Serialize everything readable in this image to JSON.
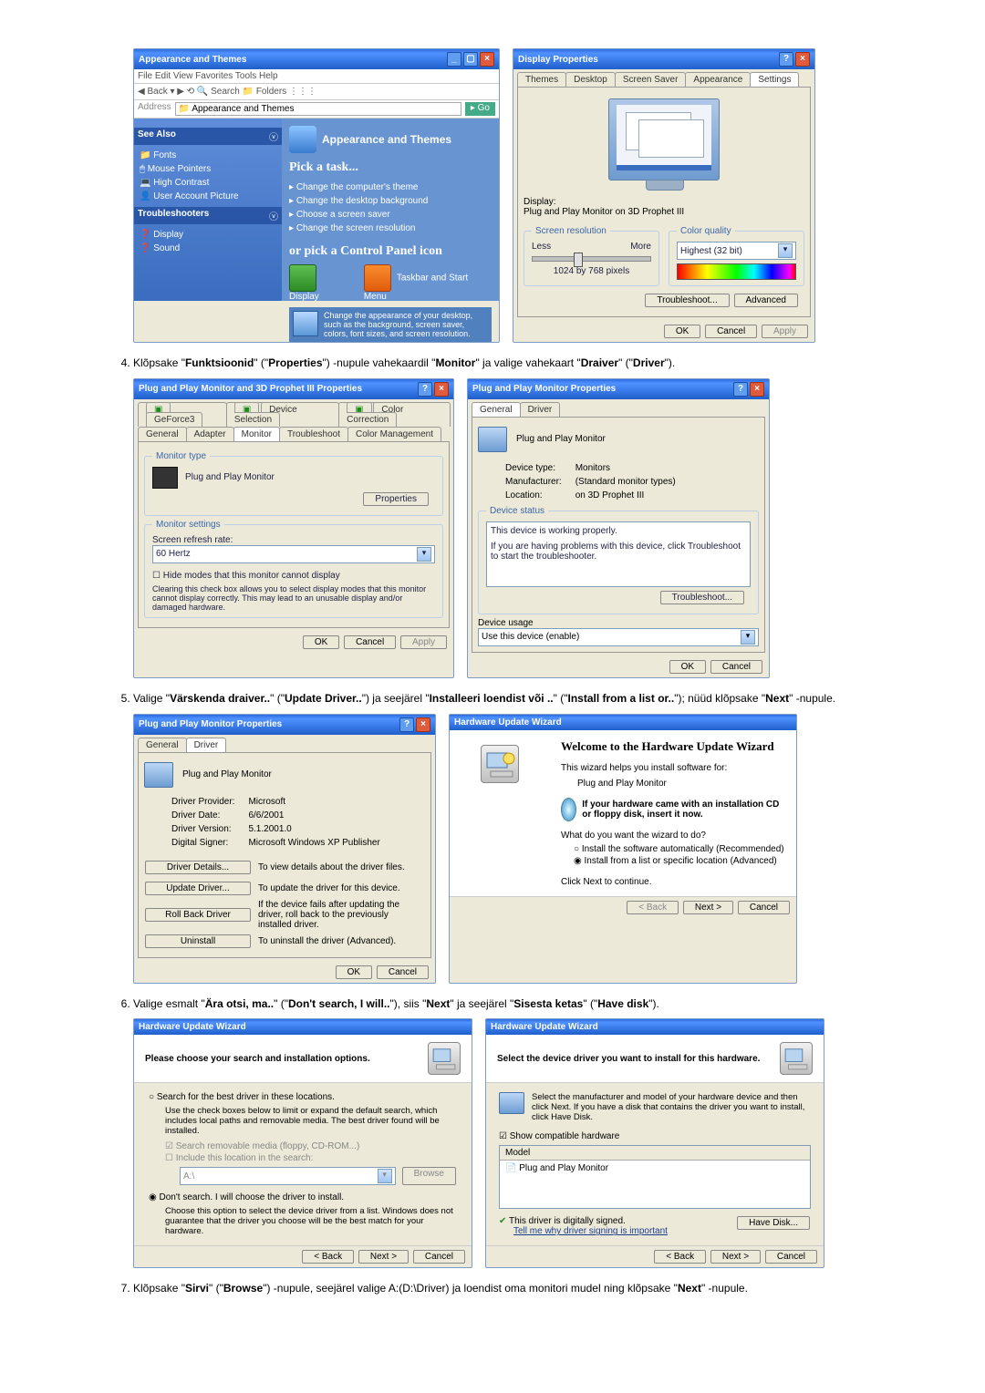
{
  "xp": {
    "title": "Appearance and Themes",
    "task_title": "Pick a task...",
    "tasks": [
      "Change the computer's theme",
      "Change the desktop background",
      "Choose a screen saver",
      "Change the screen resolution"
    ],
    "orpick": "or pick a Control Panel icon",
    "icons": [
      "Display",
      "Taskbar and Start Menu"
    ],
    "icon_note": "Change the appearance of your desktop, such as the background, screen saver, colors, font sizes, and screen resolution."
  },
  "disp": {
    "title": "Display Properties",
    "tabs": [
      "Themes",
      "Desktop",
      "Screen Saver",
      "Appearance",
      "Settings"
    ],
    "display_label": "Display:",
    "display_val": "Plug and Play Monitor on 3D Prophet III",
    "res_legend": "Screen resolution",
    "less": "Less",
    "more": "More",
    "res_val": "1024 by 768 pixels",
    "cq_legend": "Color quality",
    "cq_val": "Highest (32 bit)",
    "trouble": "Troubleshoot...",
    "adv": "Advanced",
    "ok": "OK",
    "cancel": "Cancel",
    "apply": "Apply"
  },
  "step4": "Klõpsake \"Funktsioonid\" (\"Properties\") -nupule vahekaardil \"Monitor\" ja valige vahekaart \"Draiver\" (\"Driver\").",
  "mon3d": {
    "title": "Plug and Play Monitor and 3D Prophet III Properties",
    "tabs_top": [
      "GeForce3",
      "Device Selection",
      "Color Correction"
    ],
    "tabs_bot": [
      "General",
      "Adapter",
      "Monitor",
      "Troubleshoot",
      "Color Management"
    ],
    "mt_legend": "Monitor type",
    "mt_val": "Plug and Play Monitor",
    "mt_btn": "Properties",
    "ms_legend": "Monitor settings",
    "ref_lbl": "Screen refresh rate:",
    "ref_val": "60 Hertz",
    "chk": "Hide modes that this monitor cannot display",
    "chk_note": "Clearing this check box allows you to select display modes that this monitor cannot display correctly. This may lead to an unusable display and/or damaged hardware."
  },
  "pnp_gen": {
    "title": "Plug and Play Monitor Properties",
    "tabs": [
      "General",
      "Driver"
    ],
    "name": "Plug and Play Monitor",
    "dt_lbl": "Device type:",
    "dt_val": "Monitors",
    "mf_lbl": "Manufacturer:",
    "mf_val": "(Standard monitor types)",
    "loc_lbl": "Location:",
    "loc_val": "on 3D Prophet III",
    "ds_legend": "Device status",
    "ds_txt": "This device is working properly.",
    "ds_help": "If you are having problems with this device, click Troubleshoot to start the troubleshooter.",
    "trouble": "Troubleshoot...",
    "du_legend": "Device usage",
    "du_val": "Use this device (enable)"
  },
  "step5": "Valige \"Värskenda draiver..\" (\"Update Driver..\") ja seejärel \"Installeeri loendist või ..\" (\"Install from a list or..\"); nüüd klõpsake \"Next\" -nupule.",
  "pnp_drv": {
    "title": "Plug and Play Monitor Properties",
    "tabs": [
      "General",
      "Driver"
    ],
    "name": "Plug and Play Monitor",
    "prov_lbl": "Driver Provider:",
    "prov_val": "Microsoft",
    "date_lbl": "Driver Date:",
    "date_val": "6/6/2001",
    "ver_lbl": "Driver Version:",
    "ver_val": "5.1.2001.0",
    "sig_lbl": "Digital Signer:",
    "sig_val": "Microsoft Windows XP Publisher",
    "b1": "Driver Details...",
    "b1d": "To view details about the driver files.",
    "b2": "Update Driver...",
    "b2d": "To update the driver for this device.",
    "b3": "Roll Back Driver",
    "b3d": "If the device fails after updating the driver, roll back to the previously installed driver.",
    "b4": "Uninstall",
    "b4d": "To uninstall the driver (Advanced)."
  },
  "wiz1": {
    "title": "Hardware Update Wizard",
    "welcome": "Welcome to the Hardware Update Wizard",
    "help": "This wizard helps you install software for:",
    "dev": "Plug and Play Monitor",
    "cd": "If your hardware came with an installation CD or floppy disk, insert it now.",
    "q": "What do you want the wizard to do?",
    "r1": "Install the software automatically (Recommended)",
    "r2": "Install from a list or specific location (Advanced)",
    "next": "Click Next to continue.",
    "b_back": "< Back",
    "b_next": "Next >",
    "b_cancel": "Cancel"
  },
  "step6": "Valige esmalt \"Ära otsi, ma..\" (\"Don't search, I will..\"), siis \"Next\" ja seejärel \"Sisesta ketas\" (\"Have disk\").",
  "wiz2": {
    "title": "Hardware Update Wizard",
    "hdr": "Please choose your search and installation options.",
    "r1": "Search for the best driver in these locations.",
    "r1d": "Use the check boxes below to limit or expand the default search, which includes local paths and removable media. The best driver found will be installed.",
    "c1": "Search removable media (floppy, CD-ROM...)",
    "c2": "Include this location in the search:",
    "path": "A:\\",
    "browse": "Browse",
    "r2": "Don't search. I will choose the driver to install.",
    "r2d": "Choose this option to select the device driver from a list. Windows does not guarantee that the driver you choose will be the best match for your hardware."
  },
  "wiz3": {
    "title": "Hardware Update Wizard",
    "hdr": "Select the device driver you want to install for this hardware.",
    "note": "Select the manufacturer and model of your hardware device and then click Next. If you have a disk that contains the driver you want to install, click Have Disk.",
    "show": "Show compatible hardware",
    "model_hdr": "Model",
    "model": "Plug and Play Monitor",
    "signed": "This driver is digitally signed.",
    "tell": "Tell me why driver signing is important",
    "have": "Have Disk..."
  },
  "step7": "Klõpsake \"Sirvi\" (\"Browse\") -nupule, seejärel valige A:(D:\\Driver) ja loendist oma monitori mudel ning klõpsake \"Next\" -nupule."
}
